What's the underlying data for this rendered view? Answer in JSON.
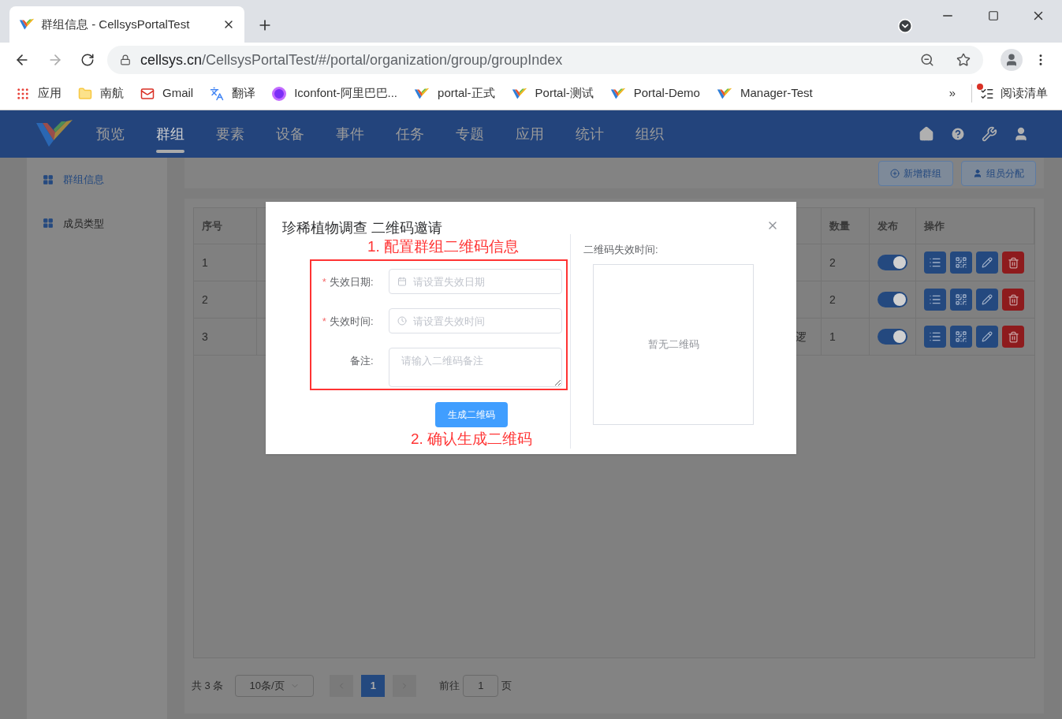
{
  "browser": {
    "tab_title": "群组信息 - CellsysPortalTest",
    "url_host": "cellsys.cn",
    "url_path": "/CellsysPortalTest/#/portal/organization/group/groupIndex",
    "bookmarks": [
      {
        "kind": "apps",
        "label": "应用"
      },
      {
        "kind": "folder",
        "label": "南航"
      },
      {
        "kind": "gmail",
        "label": "Gmail"
      },
      {
        "kind": "translate",
        "label": "翻译"
      },
      {
        "kind": "iconfont",
        "label": "Iconfont-阿里巴巴..."
      },
      {
        "kind": "logo",
        "label": "portal-正式"
      },
      {
        "kind": "logo",
        "label": "Portal-测试"
      },
      {
        "kind": "logo",
        "label": "Portal-Demo"
      },
      {
        "kind": "logo",
        "label": "Manager-Test"
      }
    ],
    "more": "»",
    "reading_list": "阅读清单"
  },
  "nav": [
    {
      "label": "预览",
      "selected": false
    },
    {
      "label": "群组",
      "selected": true
    },
    {
      "label": "要素",
      "selected": false
    },
    {
      "label": "设备",
      "selected": false
    },
    {
      "label": "事件",
      "selected": false
    },
    {
      "label": "任务",
      "selected": false
    },
    {
      "label": "专题",
      "selected": false
    },
    {
      "label": "应用",
      "selected": false
    },
    {
      "label": "统计",
      "selected": false
    },
    {
      "label": "组织",
      "selected": false
    }
  ],
  "sidebar": {
    "items": [
      {
        "label": "群组信息",
        "selected": true
      },
      {
        "label": "成员类型",
        "selected": false
      }
    ]
  },
  "toolbar": {
    "buttons": [
      "新增群组",
      "组员分配"
    ]
  },
  "table": {
    "columns": [
      "序号",
      "数量",
      "发布",
      "操作"
    ],
    "rows": [
      {
        "index": "1",
        "column_2": "",
        "count": "2",
        "published": true
      },
      {
        "index": "2",
        "column_2": "",
        "count": "2",
        "published": true
      },
      {
        "index": "3",
        "column_2": "逻",
        "count": "1",
        "published": true
      }
    ]
  },
  "pagination": {
    "total": "共 3 条",
    "page_size": "10条/页",
    "pages": [
      {
        "label": "1",
        "selected": true
      }
    ],
    "goto_label": "前往",
    "goto_value": "1",
    "goto_suffix": "页"
  },
  "dialog": {
    "title": "珍稀植物调查 二维码邀请",
    "note_1": "1. 配置群组二维码信息",
    "note_2": "2. 确认生成二维码",
    "fields": [
      {
        "kind": "date",
        "label": "失效日期:",
        "required_mark": "*",
        "placeholder": "请设置失效日期"
      },
      {
        "kind": "time",
        "label": "失效时间:",
        "required_mark": "*",
        "placeholder": "请设置失效时间"
      },
      {
        "kind": "textarea",
        "label": "备注:",
        "placeholder": "请输入二维码备注"
      }
    ],
    "submit": "生成二维码",
    "expiry_label": "二维码失效时间:",
    "qr_empty": "暂无二维码"
  }
}
